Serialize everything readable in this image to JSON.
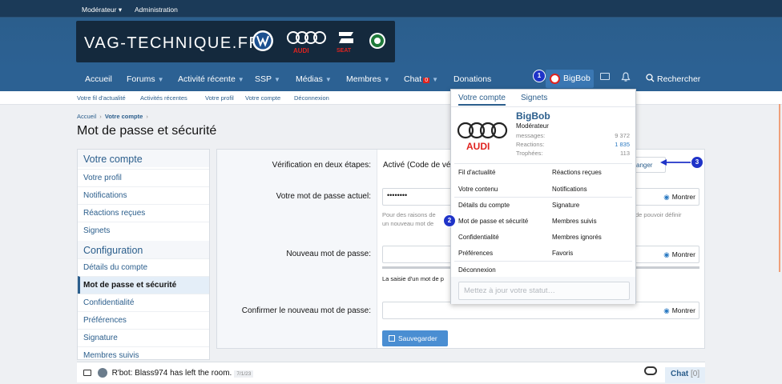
{
  "staffbar": {
    "moderator": "Modérateur ▾",
    "admin": "Administration"
  },
  "site": {
    "logo_text": "VAG-TECHNIQUE.FR",
    "brand_audi": "AUDI",
    "brand_seat": "SEAT"
  },
  "nav": {
    "items": [
      "Accueil",
      "Forums",
      "Activité récente",
      "SSP",
      "Médias",
      "Membres",
      "Chat",
      "Donations"
    ],
    "chat_badge": "0",
    "user": "BigBob",
    "search": "Rechercher"
  },
  "subnav": [
    "Votre fil d'actualité",
    "Activités récentes",
    "Votre profil",
    "Votre compte",
    "Déconnexion"
  ],
  "breadcrumb": {
    "home": "Accueil",
    "sep": "›",
    "current": "Votre compte",
    "sep2": "›"
  },
  "page": {
    "title": "Mot de passe et sécurité"
  },
  "sidebar": {
    "section1": "Votre compte",
    "items1": [
      "Votre profil",
      "Notifications",
      "Réactions reçues",
      "Signets"
    ],
    "section2": "Configuration",
    "items2": [
      "Détails du compte",
      "Mot de passe et sécurité",
      "Confidentialité",
      "Préférences",
      "Signature",
      "Membres suivis"
    ]
  },
  "form": {
    "twostep_label": "Vérification en deux étapes:",
    "twostep_value": "Activé (Code de vé",
    "change_btn": "anger",
    "current_label": "Votre mot de passe actuel:",
    "current_value": "••••••••",
    "show": "Montrer",
    "current_hint_1": "Pour des raisons de",
    "current_hint_2": "un nouveau mot de",
    "current_hint_right": "de pouvoir définir",
    "new_label": "Nouveau mot de passe:",
    "new_hint": "La saisie d'un mot de p",
    "confirm_label": "Confirmer le nouveau mot de passe:",
    "save": "Sauvegarder"
  },
  "chat": {
    "message": "R'bot: Blass974 has left the room.",
    "time": "7/1/23",
    "label": "Chat",
    "count": "[0]"
  },
  "menu": {
    "tabs": [
      "Votre compte",
      "Signets"
    ],
    "username": "BigBob",
    "role": "Modérateur",
    "stats": [
      {
        "label": "messages:",
        "value": "9 372"
      },
      {
        "label": "Reactions:",
        "value": "1 835"
      },
      {
        "label": "Trophées:",
        "value": "113"
      }
    ],
    "links_left": [
      "Fil d'actualité",
      "Votre contenu",
      "Détails du compte",
      "Mot de passe et sécurité",
      "Confidentialité",
      "Préférences"
    ],
    "links_right": [
      "Réactions reçues",
      "Notifications",
      "Signature",
      "Membres suivis",
      "Membres ignorés",
      "Favoris"
    ],
    "logout": "Déconnexion",
    "status_placeholder": "Mettez à jour votre statut…"
  },
  "markers": [
    "1",
    "2",
    "3"
  ],
  "colors": {
    "primary": "#2b5e8c",
    "nav_bg": "#2c6193",
    "marker": "#1f33c8",
    "save": "#4a8ed2"
  }
}
